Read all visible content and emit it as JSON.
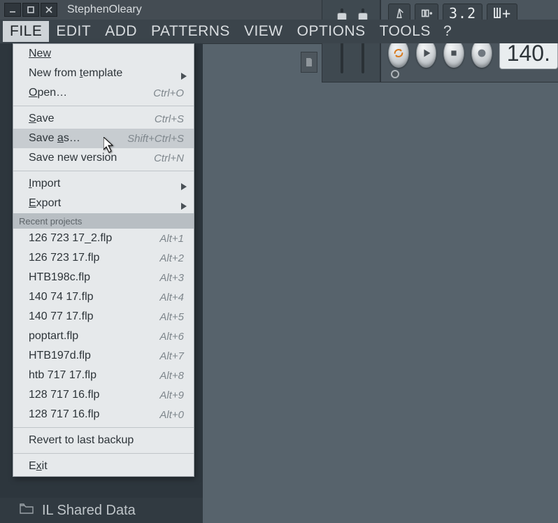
{
  "app": {
    "title": "StephenOleary"
  },
  "menubar": {
    "file": "FILE",
    "edit": "EDIT",
    "add": "ADD",
    "patterns": "PATTERNS",
    "view": "VIEW",
    "options": "OPTIONS",
    "tools": "TOOLS",
    "help": "?"
  },
  "toolbar": {
    "display1": "3.2",
    "display2": "Ш+",
    "tempo": "140."
  },
  "file_menu": {
    "new": "New",
    "new_from_template": "New from template",
    "open": "Open…",
    "open_hint": "Ctrl+O",
    "save": "Save",
    "save_hint": "Ctrl+S",
    "save_as": "Save as…",
    "save_as_hint": "Shift+Ctrl+S",
    "save_new_version": "Save new version",
    "save_new_version_hint": "Ctrl+N",
    "import": "Import",
    "export": "Export",
    "recent_header": "Recent projects",
    "recent": [
      {
        "name": "126 723 17_2.flp",
        "hint": "Alt+1"
      },
      {
        "name": "126 723 17.flp",
        "hint": "Alt+2"
      },
      {
        "name": "HTB198c.flp",
        "hint": "Alt+3"
      },
      {
        "name": "140 74 17.flp",
        "hint": "Alt+4"
      },
      {
        "name": "140 77 17.flp",
        "hint": "Alt+5"
      },
      {
        "name": "poptart.flp",
        "hint": "Alt+6"
      },
      {
        "name": "HTB197d.flp",
        "hint": "Alt+7"
      },
      {
        "name": "htb 717 17.flp",
        "hint": "Alt+8"
      },
      {
        "name": "128 717 16.flp",
        "hint": "Alt+9"
      },
      {
        "name": "128 717 16.flp",
        "hint": "Alt+0"
      }
    ],
    "revert": "Revert to last backup",
    "exit": "Exit"
  },
  "sidebar": {
    "shared": "IL Shared Data"
  }
}
